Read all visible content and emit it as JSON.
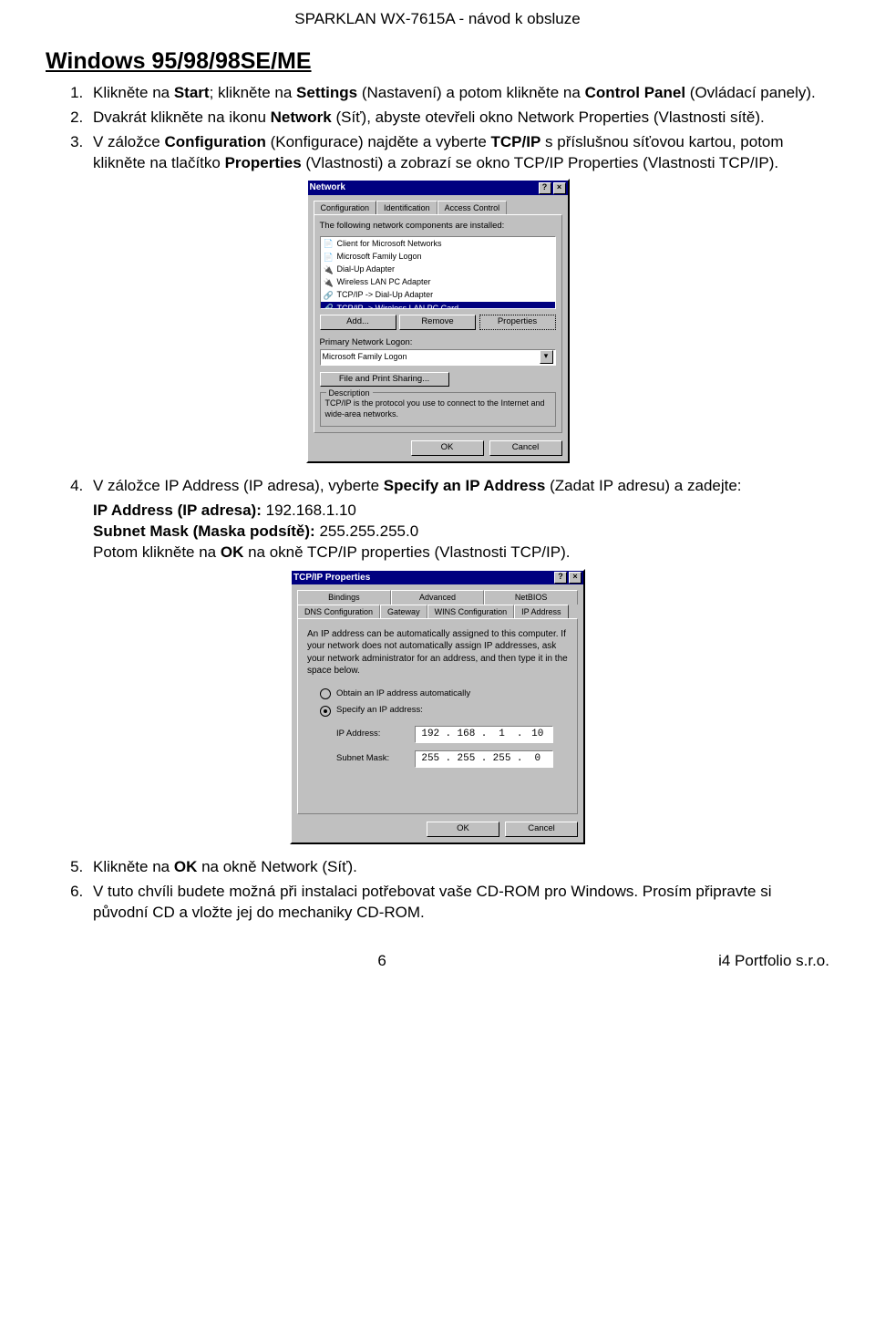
{
  "header": "SPARKLAN WX-7615A - návod k obsluze",
  "section_title": "Windows 95/98/98SE/ME",
  "steps": {
    "s1_a": "Klikněte na ",
    "s1_b": "Start",
    "s1_c": "; klikněte na ",
    "s1_d": "Settings",
    "s1_e": " (Nastavení) a potom klikněte na ",
    "s1_f": "Control Panel",
    "s1_g": " (Ovládací panely).",
    "s2_a": "Dvakrát klikněte na ikonu ",
    "s2_b": "Network",
    "s2_c": " (Síť), abyste otevřeli okno Network Properties (Vlastnosti sítě).",
    "s3_a": "V záložce ",
    "s3_b": "Configuration",
    "s3_c": " (Konfigurace) najděte a vyberte ",
    "s3_d": "TCP/IP",
    "s3_e": " s příslušnou síťovou kartou, potom klikněte na tlačítko ",
    "s3_f": "Properties",
    "s3_g": " (Vlastnosti) a zobrazí se okno TCP/IP Properties (Vlastnosti TCP/IP).",
    "s4_a": "V záložce IP Address (IP adresa), vyberte ",
    "s4_b": "Specify an IP Address",
    "s4_c": " (Zadat IP adresu) a zadejte:",
    "s4_ip_label": "IP Address (IP adresa): ",
    "s4_ip_value": "192.168.1.10",
    "s4_mask_label": "Subnet Mask (Maska podsítě): ",
    "s4_mask_value": "255.255.255.0",
    "s4_d": "Potom klikněte na ",
    "s4_e": "OK",
    "s4_f": " na okně TCP/IP properties (Vlastnosti TCP/IP).",
    "s5_a": "Klikněte na ",
    "s5_b": "OK",
    "s5_c": " na okně Network (Síť).",
    "s6": "V tuto chvíli budete možná při instalaci potřebovat vaše CD-ROM pro Windows. Prosím připravte si původní CD a vložte jej do mechaniky CD-ROM."
  },
  "dlg1": {
    "title": "Network",
    "tabs": [
      "Configuration",
      "Identification",
      "Access Control"
    ],
    "instruction": "The following network components are installed:",
    "list": [
      "Client for Microsoft Networks",
      "Microsoft Family Logon",
      "Dial-Up Adapter",
      "Wireless LAN PC Adapter",
      "TCP/IP -> Dial-Up Adapter",
      "TCP/IP -> Wireless LAN PC Card"
    ],
    "btn_add": "Add...",
    "btn_remove": "Remove",
    "btn_props": "Properties",
    "primary_logon_label": "Primary Network Logon:",
    "primary_logon_value": "Microsoft Family Logon",
    "file_sharing": "File and Print Sharing...",
    "desc_title": "Description",
    "desc_text": "TCP/IP is the protocol you use to connect to the Internet and wide-area networks.",
    "ok": "OK",
    "cancel": "Cancel"
  },
  "dlg2": {
    "title": "TCP/IP Properties",
    "tabs_row1": [
      "Bindings",
      "Advanced",
      "NetBIOS"
    ],
    "tabs_row2": [
      "DNS Configuration",
      "Gateway",
      "WINS Configuration",
      "IP Address"
    ],
    "instruction": "An IP address can be automatically assigned to this computer. If your network does not automatically assign IP addresses, ask your network administrator for an address, and then type it in the space below.",
    "opt_auto": "Obtain an IP address automatically",
    "opt_specify": "Specify an IP address:",
    "ip_label": "IP Address:",
    "ip_parts": [
      "192",
      "168",
      "1",
      "10"
    ],
    "mask_label": "Subnet Mask:",
    "mask_parts": [
      "255",
      "255",
      "255",
      "0"
    ],
    "ok": "OK",
    "cancel": "Cancel"
  },
  "footer": {
    "page": "6",
    "right": "i4 Portfolio s.r.o."
  }
}
